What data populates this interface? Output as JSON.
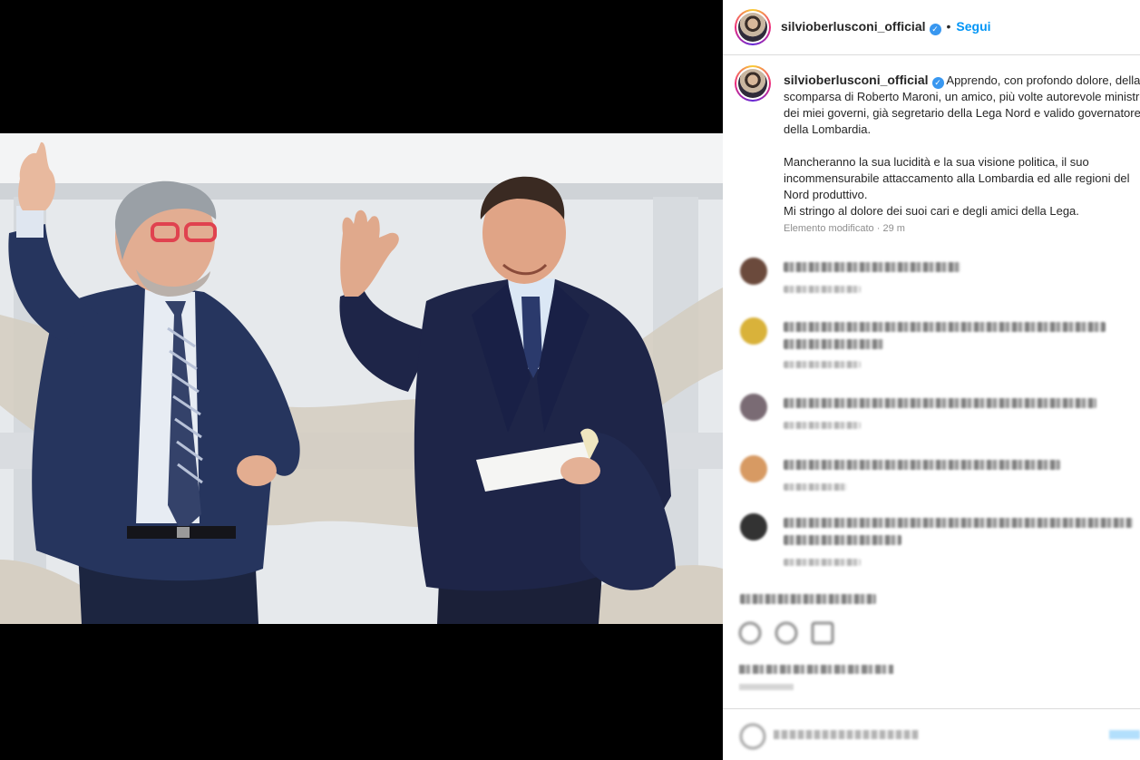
{
  "post": {
    "username": "silvioberlusconi_official",
    "follow_label": "Segui",
    "separator": "•",
    "verified_glyph": "✓",
    "caption_lines": [
      "Apprendo, con profondo dolore, della scomparsa di Roberto Maroni, un amico, più volte autorevole ministro dei miei governi, già segretario della Lega Nord e valido governatore della Lombardia.",
      "Mancheranno la sua lucidità e la sua visione politica, il suo incommensurabile attaccamento alla Lombardia ed alle regioni del Nord produttivo.",
      "Mi stringo al dolore dei suoi cari e degli amici della Lega."
    ],
    "edited_label": "Elemento modificato",
    "time_ago": "29 m"
  },
  "colors": {
    "link_blue": "#0095f6",
    "verified_blue": "#3897f0",
    "meta_gray": "#8e8e8e",
    "border": "#dbdbdb"
  },
  "icons": [
    "verified-badge-icon",
    "heart-icon",
    "comment-icon",
    "share-icon",
    "emoji-icon"
  ]
}
